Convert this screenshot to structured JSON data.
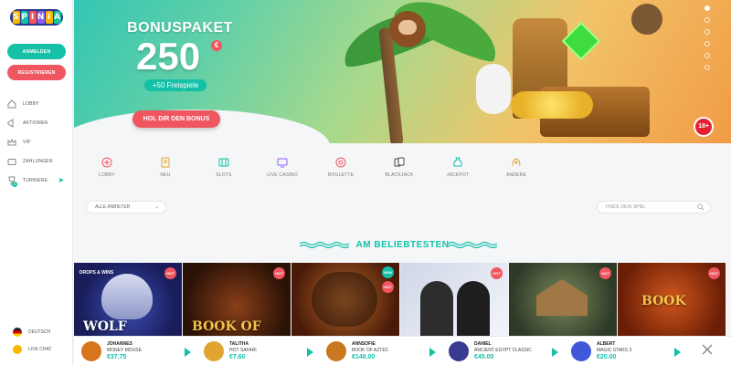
{
  "sidebar": {
    "logo_letters": [
      "S",
      "P",
      "I",
      "N",
      "I",
      "A"
    ],
    "logo_colors": [
      "#f6b800",
      "#14c1a7",
      "#f0565f",
      "#8b5cf6",
      "#f6b800",
      "#14c1a7"
    ],
    "login_label": "ANMELDEN",
    "register_label": "REGISTRIEREN",
    "nav": [
      {
        "label": "LOBBY",
        "icon": "lobby-icon"
      },
      {
        "label": "AKTIONEN",
        "icon": "megaphone-icon"
      },
      {
        "label": "VIP",
        "icon": "crown-icon"
      },
      {
        "label": "ZAHLUNGEN",
        "icon": "wallet-icon"
      },
      {
        "label": "TURNIERE",
        "icon": "trophy-icon",
        "badge": "3"
      }
    ],
    "language": "DEUTSCH",
    "live_chat": "LIVE CHAT"
  },
  "hero": {
    "title": "BONUSPAKET",
    "amount": "250",
    "currency": "€",
    "free_spins": "+50 Freispiele",
    "cta": "HOL DIR DEN BONUS",
    "age_badge": "18+",
    "slide_count": 6,
    "active_slide": 1
  },
  "categories": [
    {
      "label": "LOBBY",
      "icon": "lobby-icon"
    },
    {
      "label": "NEU",
      "icon": "new-icon"
    },
    {
      "label": "SLOTS",
      "icon": "slots-icon"
    },
    {
      "label": "LIVE CASINO",
      "icon": "live-casino-icon"
    },
    {
      "label": "ROULETTE",
      "icon": "roulette-icon"
    },
    {
      "label": "BLACKJACK",
      "icon": "cards-icon"
    },
    {
      "label": "JACKPOT",
      "icon": "money-bag-icon"
    },
    {
      "label": "ANDERE",
      "icon": "other-icon"
    }
  ],
  "filters": {
    "provider": "ALLE ANBIETER",
    "search_placeholder": "FINDE DEIN SPIEL"
  },
  "section_title": "AM BELIEBTESTEN",
  "games": [
    {
      "badge": "HOT",
      "art_text": "WOLF",
      "extra": "DROPS & WINS"
    },
    {
      "badge": "HOT",
      "art_text": "BOOK OF"
    },
    {
      "badge": "HOT",
      "badge2": "NEW",
      "art_text": ""
    },
    {
      "badge": "HOT",
      "art_text": ""
    },
    {
      "badge": "HOT",
      "art_text": ""
    },
    {
      "badge": "HOT",
      "art_text": "BOOK"
    }
  ],
  "winners": [
    {
      "name": "JOHANNES",
      "game": "MONEY MOUSE",
      "amount": "€37.75",
      "color": "#d8741c"
    },
    {
      "name": "TALITHA",
      "game": "HOT SAFARI",
      "amount": "€7.60",
      "color": "#e0a431"
    },
    {
      "name": "ANNSOFIE",
      "game": "BOOK OF AZTEC",
      "amount": "€148.00",
      "color": "#c9781f"
    },
    {
      "name": "DANIEL",
      "game": "ANCIENT EGYPT CLASSIC",
      "amount": "€45.00",
      "color": "#3a3a90"
    },
    {
      "name": "ALBERT",
      "game": "MAGIC STARS 3",
      "amount": "€20.00",
      "color": "#3f57d8"
    }
  ],
  "colors": {
    "accent": "#14c1a7",
    "danger": "#f0565f"
  }
}
